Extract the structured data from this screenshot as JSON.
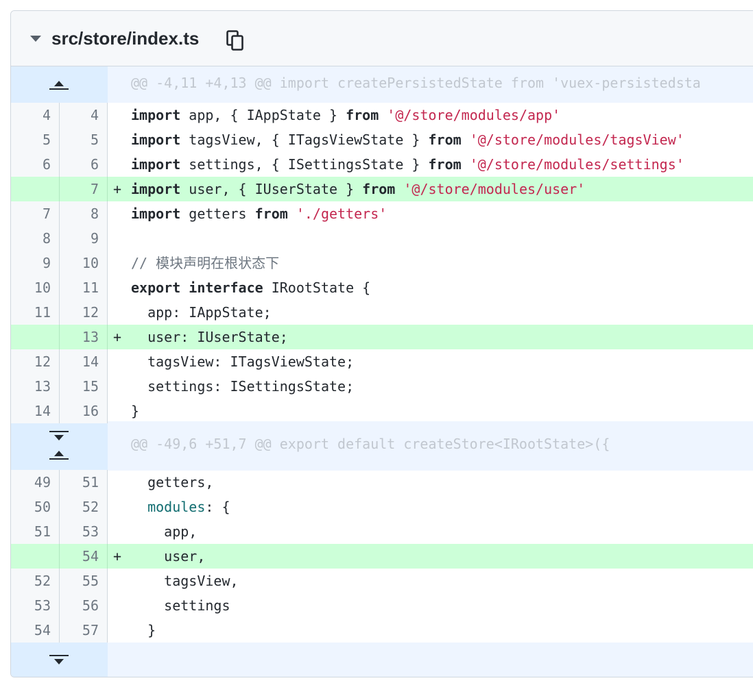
{
  "file": {
    "name": "src/store/index.ts"
  },
  "hunks": [
    {
      "header": "@@ -4,11 +4,13 @@ import createPersistedState from 'vuex-persistedsta"
    },
    {
      "header": "@@ -49,6 +51,7 @@ export default createStore<IRootState>({"
    }
  ],
  "lines": [
    {
      "old": "4",
      "new": "4",
      "marker": "",
      "type": "context"
    },
    {
      "old": "5",
      "new": "5",
      "marker": "",
      "type": "context"
    },
    {
      "old": "6",
      "new": "6",
      "marker": "",
      "type": "context"
    },
    {
      "old": "",
      "new": "7",
      "marker": "+",
      "type": "add"
    },
    {
      "old": "7",
      "new": "8",
      "marker": "",
      "type": "context"
    },
    {
      "old": "8",
      "new": "9",
      "marker": "",
      "type": "context"
    },
    {
      "old": "9",
      "new": "10",
      "marker": "",
      "type": "context"
    },
    {
      "old": "10",
      "new": "11",
      "marker": "",
      "type": "context"
    },
    {
      "old": "11",
      "new": "12",
      "marker": "",
      "type": "context"
    },
    {
      "old": "",
      "new": "13",
      "marker": "+",
      "type": "add"
    },
    {
      "old": "12",
      "new": "14",
      "marker": "",
      "type": "context"
    },
    {
      "old": "13",
      "new": "15",
      "marker": "",
      "type": "context"
    },
    {
      "old": "14",
      "new": "16",
      "marker": "",
      "type": "context"
    },
    {
      "old": "49",
      "new": "51",
      "marker": "",
      "type": "context"
    },
    {
      "old": "50",
      "new": "52",
      "marker": "",
      "type": "context"
    },
    {
      "old": "51",
      "new": "53",
      "marker": "",
      "type": "context"
    },
    {
      "old": "",
      "new": "54",
      "marker": "+",
      "type": "add"
    },
    {
      "old": "52",
      "new": "55",
      "marker": "",
      "type": "context"
    },
    {
      "old": "53",
      "new": "56",
      "marker": "",
      "type": "context"
    },
    {
      "old": "54",
      "new": "57",
      "marker": "",
      "type": "context"
    }
  ],
  "code": {
    "l0": {
      "a": "import",
      "b": " app, { IAppState } ",
      "c": "from",
      "d": " '",
      "e": "@/store/modules/app",
      "f": "'"
    },
    "l1": {
      "a": "import",
      "b": " tagsView, { ITagsViewState } ",
      "c": "from",
      "d": " '",
      "e": "@/store/modules/tagsView",
      "f": "'"
    },
    "l2": {
      "a": "import",
      "b": " settings, { ISettingsState } ",
      "c": "from",
      "d": " '",
      "e": "@/store/modules/settings",
      "f": "'"
    },
    "l3": {
      "a": "import",
      "b": " user, { IUserState } ",
      "c": "from",
      "d": " '",
      "e": "@/store/modules/user",
      "f": "'"
    },
    "l4": {
      "a": "import",
      "b": " getters ",
      "c": "from",
      "d": " '",
      "e": "./getters",
      "f": "'"
    },
    "l5": "",
    "l6": "// 模块声明在根状态下",
    "l7": {
      "a": "export",
      "b": " ",
      "c": "interface",
      "d": " IRootState {"
    },
    "l8": "  app: IAppState;",
    "l9": "  user: IUserState;",
    "l10": "  tagsView: ITagsViewState;",
    "l11": "  settings: ISettingsState;",
    "l12": "}",
    "l13": "  getters,",
    "l14": {
      "a": "  ",
      "b": "modules",
      "c": ": {"
    },
    "l15": "    app,",
    "l16": "    user,",
    "l17": "    tagsView,",
    "l18": "    settings",
    "l19": "  }"
  },
  "colors": {
    "addition_bg": "#ccffd8",
    "hunk_bg": "#eef5ff",
    "expander_bg": "#ddeeff",
    "string": "#c3274f",
    "property": "#116d70"
  },
  "icons": [
    "chevron-down-icon",
    "copy-icon",
    "expand-up-icon",
    "expand-down-icon"
  ]
}
